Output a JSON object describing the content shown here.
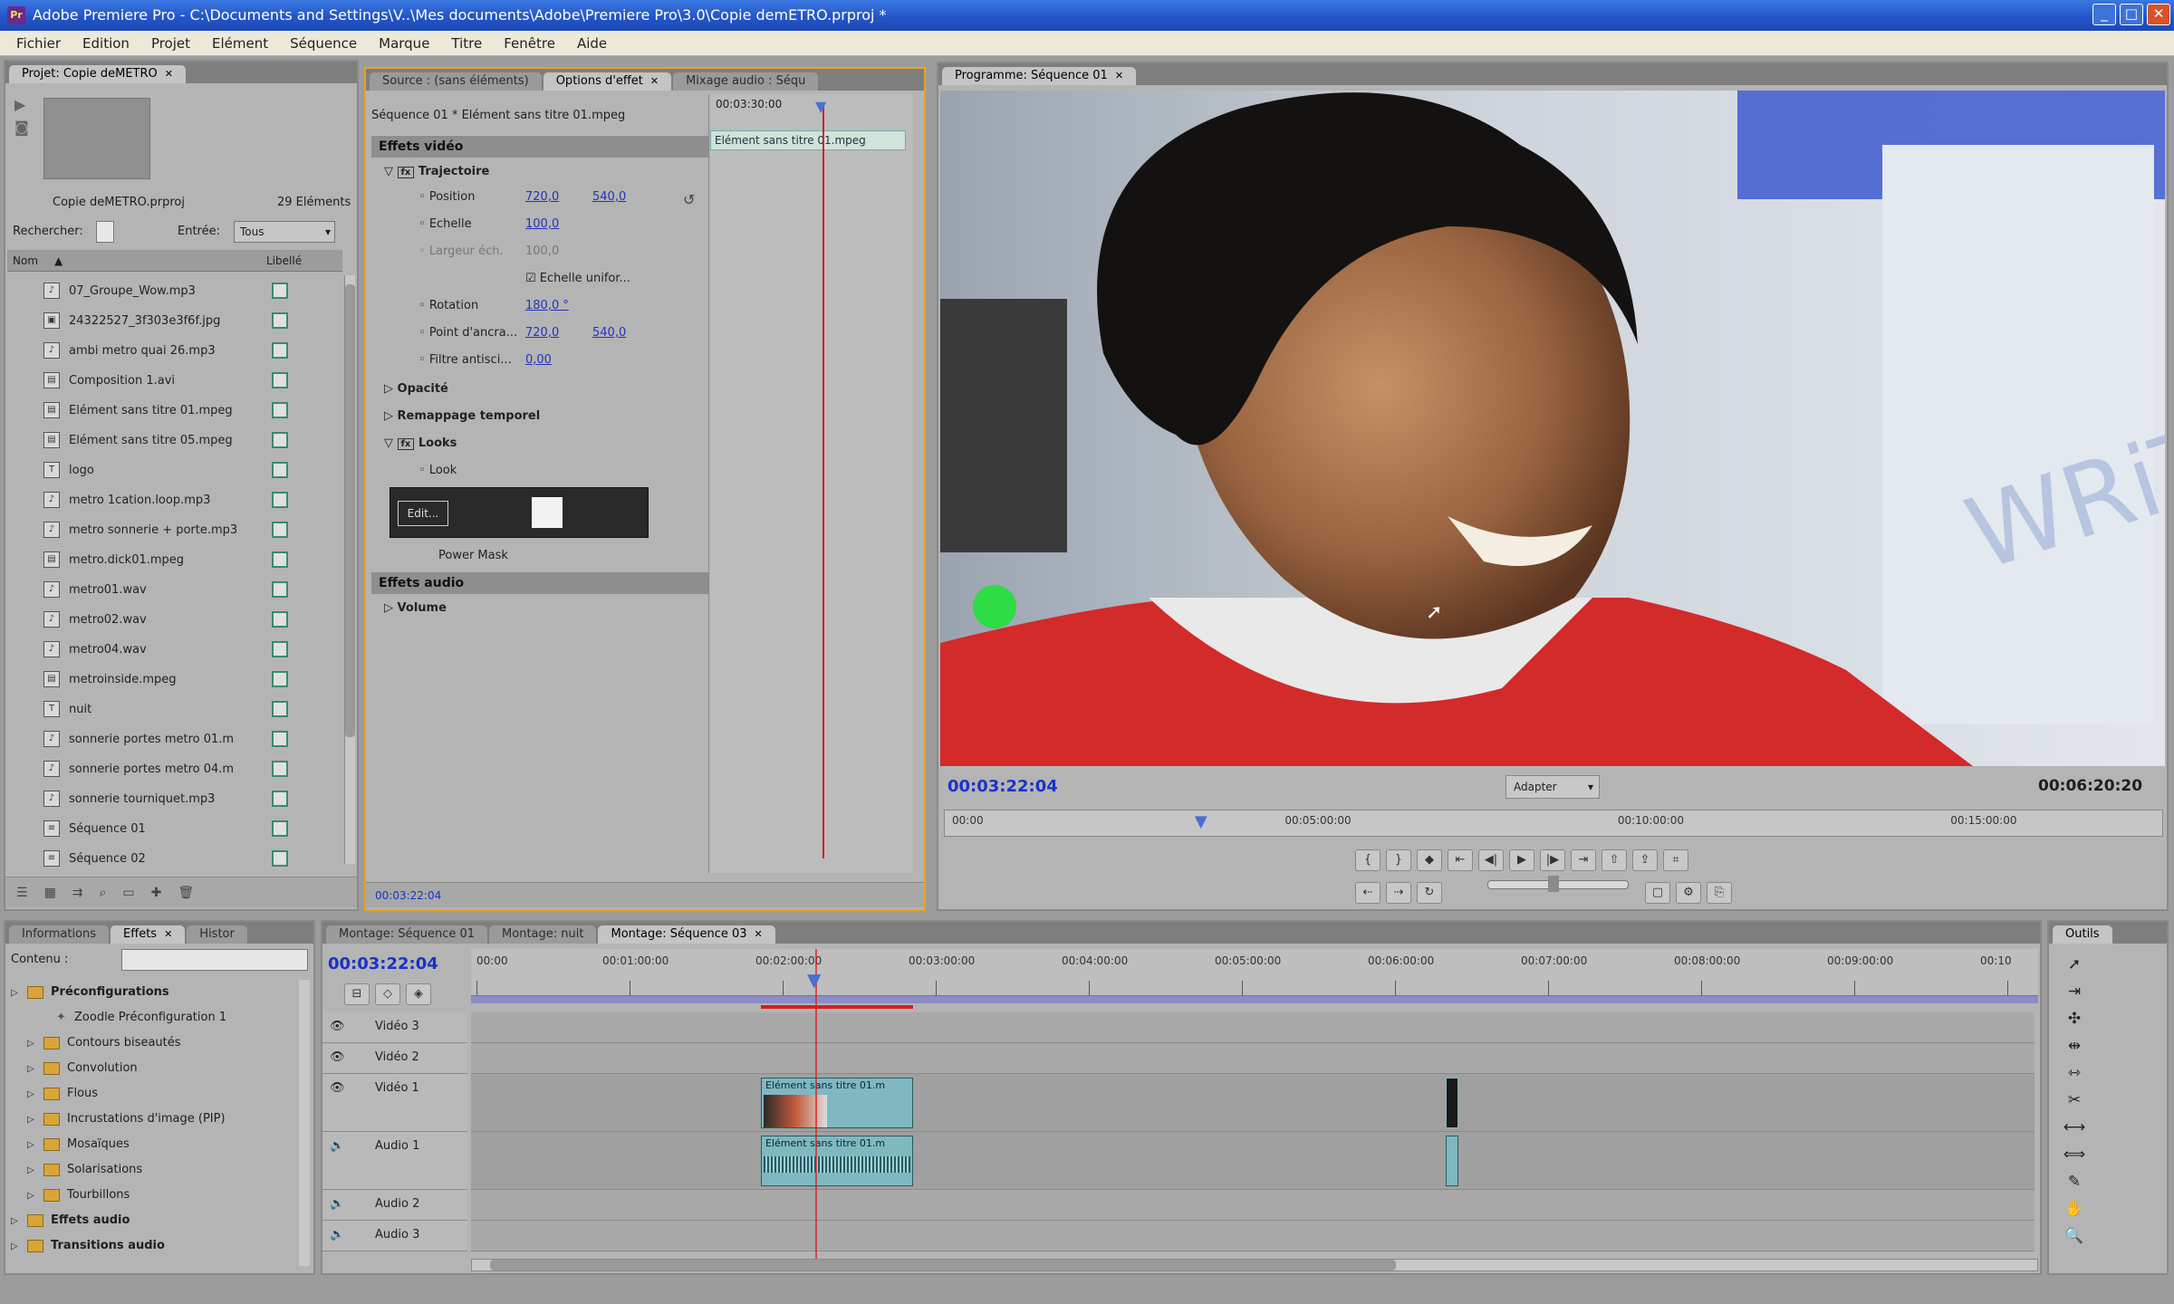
{
  "window": {
    "title": "Adobe Premiere Pro - C:\\Documents and Settings\\V..\\Mes documents\\Adobe\\Premiere Pro\\3.0\\Copie demETRO.prproj *",
    "minimize": "_",
    "maximize": "□",
    "close": "✕",
    "app_icon": "Pr"
  },
  "menu": [
    "Fichier",
    "Edition",
    "Projet",
    "Elément",
    "Séquence",
    "Marque",
    "Titre",
    "Fenêtre",
    "Aide"
  ],
  "project": {
    "tab": "Projet: Copie deMETRO",
    "file": "Copie deMETRO.prproj",
    "count": "29 Eléments",
    "search_label": "Rechercher:",
    "entry_label": "Entrée:",
    "entry_value": "Tous",
    "col_name": "Nom",
    "col_label": "Libellé",
    "items": [
      {
        "name": "07_Groupe_Wow.mp3",
        "icon": "audio-icon",
        "glyph": "♪"
      },
      {
        "name": "24322527_3f303e3f6f.jpg",
        "icon": "image-icon",
        "glyph": "▣"
      },
      {
        "name": "ambi metro quai 26.mp3",
        "icon": "audio-icon",
        "glyph": "♪"
      },
      {
        "name": "Composition 1.avi",
        "icon": "video-icon",
        "glyph": "▤"
      },
      {
        "name": "Elément sans titre 01.mpeg",
        "icon": "video-icon",
        "glyph": "▤"
      },
      {
        "name": "Elément sans titre 05.mpeg",
        "icon": "video-icon",
        "glyph": "▤"
      },
      {
        "name": "logo",
        "icon": "title-icon",
        "glyph": "T"
      },
      {
        "name": "metro 1cation.loop.mp3",
        "icon": "audio-icon",
        "glyph": "♪"
      },
      {
        "name": "metro sonnerie + porte.mp3",
        "icon": "audio-icon",
        "glyph": "♪"
      },
      {
        "name": "metro.dick01.mpeg",
        "icon": "video-icon",
        "glyph": "▤"
      },
      {
        "name": "metro01.wav",
        "icon": "audio-icon",
        "glyph": "♪"
      },
      {
        "name": "metro02.wav",
        "icon": "audio-icon",
        "glyph": "♪"
      },
      {
        "name": "metro04.wav",
        "icon": "audio-icon",
        "glyph": "♪"
      },
      {
        "name": "metroinside.mpeg",
        "icon": "video-icon",
        "glyph": "▤"
      },
      {
        "name": "nuit",
        "icon": "title-icon",
        "glyph": "T"
      },
      {
        "name": "sonnerie portes metro 01.m",
        "icon": "audio-icon",
        "glyph": "♪"
      },
      {
        "name": "sonnerie portes metro 04.m",
        "icon": "audio-icon",
        "glyph": "♪"
      },
      {
        "name": "sonnerie tourniquet.mp3",
        "icon": "audio-icon",
        "glyph": "♪"
      },
      {
        "name": "Séquence 01",
        "icon": "sequence-icon",
        "glyph": "≡"
      },
      {
        "name": "Séquence 02",
        "icon": "sequence-icon",
        "glyph": "≡"
      }
    ]
  },
  "effect_controls": {
    "tabs": [
      "Source : (sans éléments)",
      "Options d'effet",
      "Mixage audio : Séqu"
    ],
    "clip_path": "Séquence 01 * Elément sans titre 01.mpeg",
    "mini_timecode": "00:03:30:00",
    "mini_clip": "Elément sans titre 01.mpeg",
    "video_section": "Effets vidéo",
    "audio_section": "Effets audio",
    "motion": "Trajectoire",
    "position_label": "Position",
    "position_x": "720,0",
    "position_y": "540,0",
    "scale_label": "Echelle",
    "scale_value": "100,0",
    "width_label": "Largeur éch.",
    "width_value": "100,0",
    "uniform_label": "Echelle unifor...",
    "rotation_label": "Rotation",
    "rotation_value": "180,0 °",
    "anchor_label": "Point d'ancra...",
    "anchor_x": "720,0",
    "anchor_y": "540,0",
    "flicker_label": "Filtre antisci...",
    "flicker_value": "0,00",
    "opacity": "Opacité",
    "time_remap": "Remappage temporel",
    "looks": "Looks",
    "look_label": "Look",
    "look_edit": "Edit...",
    "power_mask": "Power Mask",
    "volume": "Volume",
    "timecode": "00:03:22:04"
  },
  "program": {
    "tab": "Programme: Séquence 01",
    "timecode": "00:03:22:04",
    "fit": "Adapter",
    "duration": "00:06:20:20",
    "ruler": [
      "00:00",
      "00:05:00:00",
      "00:10:00:00",
      "00:15:00:00"
    ],
    "playhead_fraction": 0.205
  },
  "info_panel": {
    "tabs": [
      "Informations",
      "Effets",
      "Histor"
    ],
    "contains_label": "Contenu :",
    "tree": [
      {
        "label": "Préconfigurations",
        "bold": true,
        "level": 0
      },
      {
        "label": "Zoodle Préconfiguration 1",
        "bold": false,
        "level": 2
      },
      {
        "label": "Contours biseautés",
        "bold": false,
        "level": 1
      },
      {
        "label": "Convolution",
        "bold": false,
        "level": 1
      },
      {
        "label": "Flous",
        "bold": false,
        "level": 1
      },
      {
        "label": "Incrustations d'image (PIP)",
        "bold": false,
        "level": 1
      },
      {
        "label": "Mosaïques",
        "bold": false,
        "level": 1
      },
      {
        "label": "Solarisations",
        "bold": false,
        "level": 1
      },
      {
        "label": "Tourbillons",
        "bold": false,
        "level": 1
      },
      {
        "label": "Effets audio",
        "bold": true,
        "level": 0
      },
      {
        "label": "Transitions audio",
        "bold": true,
        "level": 0
      }
    ]
  },
  "timeline": {
    "tabs": [
      "Montage: Séquence 01",
      "Montage: nuit",
      "Montage: Séquence 03"
    ],
    "timecode": "00:03:22:04",
    "ruler": [
      "00:00",
      "00:01:00:00",
      "00:02:00:00",
      "00:03:00:00",
      "00:04:00:00",
      "00:05:00:00",
      "00:06:00:00",
      "00:07:00:00",
      "00:08:00:00",
      "00:09:00:00",
      "00:10"
    ],
    "tracks": [
      "Vidéo 3",
      "Vidéo 2",
      "Vidéo 1",
      "Audio 1",
      "Audio 2",
      "Audio 3"
    ],
    "clip_label": "Elément sans titre 01.m"
  },
  "tools": {
    "title": "Outils",
    "items": [
      "selection-tool-icon",
      "track-select-tool-icon",
      "ripple-edit-tool-icon",
      "rolling-edit-tool-icon",
      "rate-stretch-tool-icon",
      "razor-tool-icon",
      "slip-tool-icon",
      "slide-tool-icon",
      "pen-tool-icon",
      "hand-tool-icon",
      "zoom-tool-icon"
    ]
  },
  "colors": {
    "timecode_blue": "#1a32c8",
    "playhead_red": "#d42020",
    "selection_orange": "#e8a321",
    "clip_teal": "#7fb8c0"
  }
}
